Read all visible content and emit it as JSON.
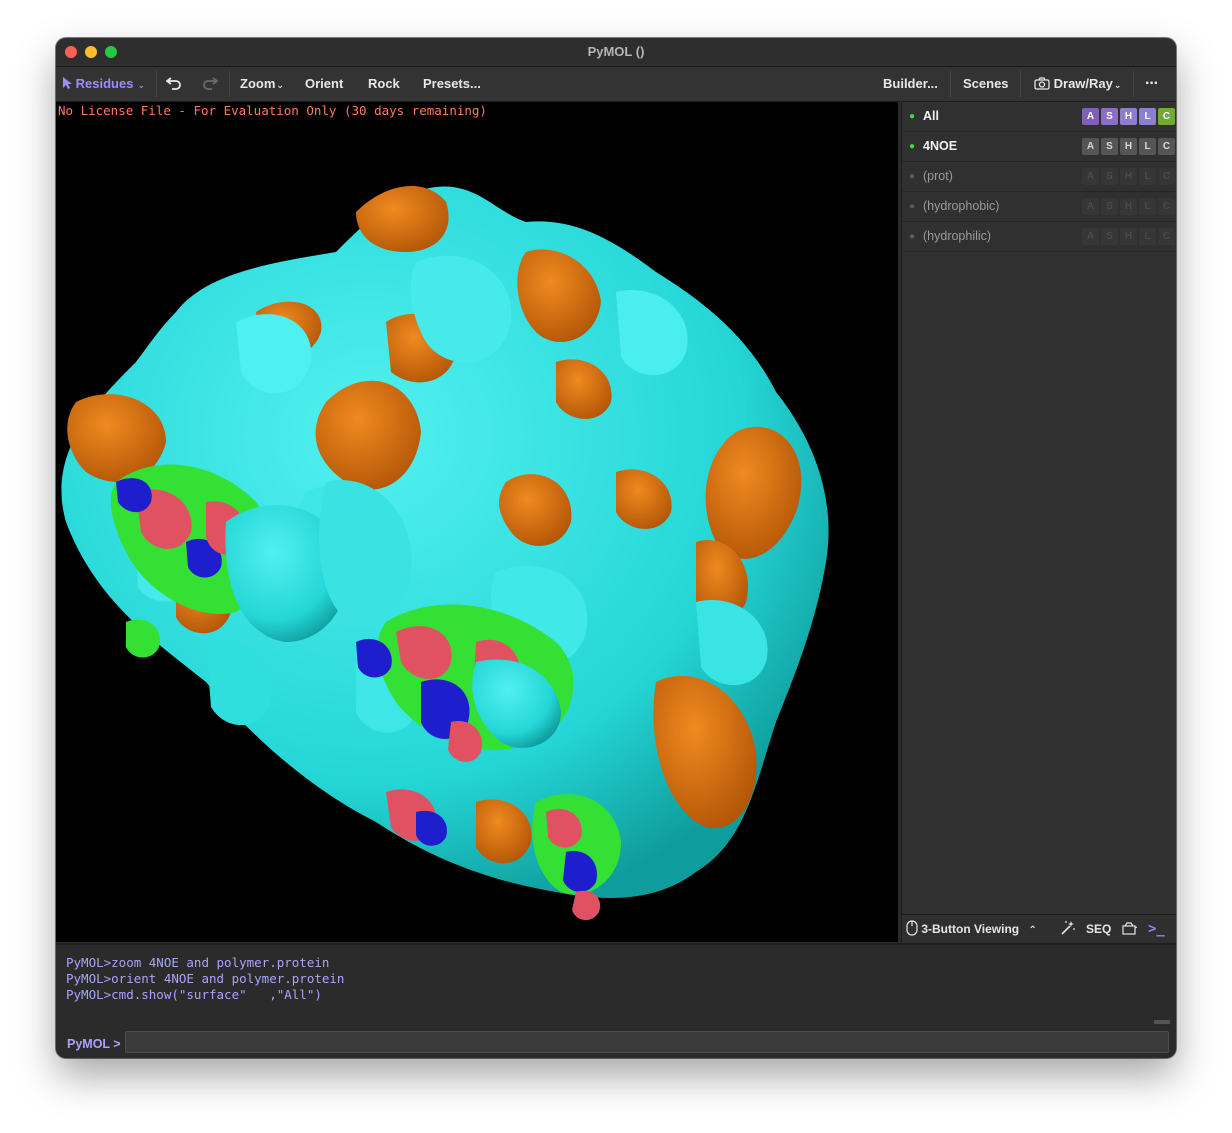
{
  "window": {
    "title": "PyMOL ()"
  },
  "toolbar": {
    "residues_label": "Residues",
    "zoom_label": "Zoom",
    "orient_label": "Orient",
    "rock_label": "Rock",
    "presets_label": "Presets...",
    "builder_label": "Builder...",
    "scenes_label": "Scenes",
    "drawray_label": "Draw/Ray",
    "more_label": "···"
  },
  "viewport": {
    "license_notice": "No License File - For Evaluation Only (30 days remaining)",
    "colors": {
      "background": "#000000",
      "hydrophilic": "#33e0e0",
      "hydrophobic": "#e5760e",
      "ligand_green": "#33e033",
      "ligand_red": "#e05262",
      "ligand_blue": "#1e1ecc"
    }
  },
  "object_panel": {
    "objects": [
      {
        "name": "All",
        "enabled": true,
        "buttons": [
          "A",
          "S",
          "H",
          "L",
          "C"
        ],
        "style": "all"
      },
      {
        "name": "4NOE",
        "enabled": true,
        "buttons": [
          "A",
          "S",
          "H",
          "L",
          "C"
        ],
        "style": "object"
      },
      {
        "name": "(prot)",
        "enabled": false,
        "buttons": [
          "A",
          "S",
          "H",
          "L",
          "C"
        ],
        "style": "selection"
      },
      {
        "name": "(hydrophobic)",
        "enabled": false,
        "buttons": [
          "A",
          "S",
          "H",
          "L",
          "C"
        ],
        "style": "selection"
      },
      {
        "name": "(hydrophilic)",
        "enabled": false,
        "buttons": [
          "A",
          "S",
          "H",
          "L",
          "C"
        ],
        "style": "selection"
      }
    ],
    "bottom": {
      "viewing_mode": "3-Button Viewing",
      "seq_label": "SEQ"
    }
  },
  "console": {
    "log": [
      "PyMOL>zoom 4NOE and polymer.protein",
      "PyMOL>orient 4NOE and polymer.protein",
      "PyMOL>cmd.show(\"surface\"   ,\"All\")"
    ],
    "prompt": "PyMOL >",
    "input_value": ""
  }
}
